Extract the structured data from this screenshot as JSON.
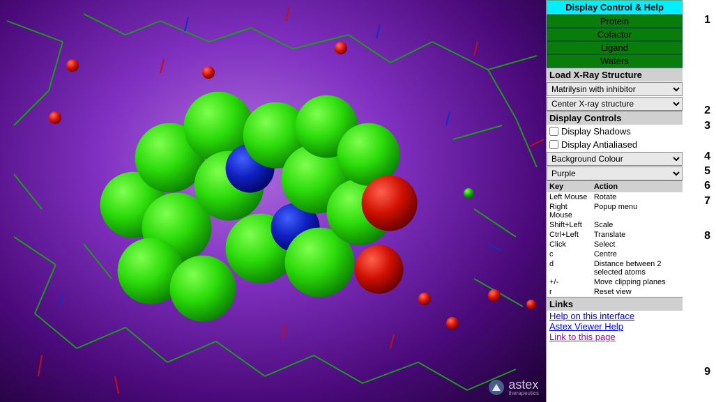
{
  "logo": {
    "name": "astex",
    "sub": "therapeutics"
  },
  "sidebar": {
    "title": "Display Control & Help",
    "green_items": [
      "Protein",
      "Cofactor",
      "Ligand",
      "Waters"
    ],
    "load_header": "Load X-Ray Structure",
    "structure_select": "Matrilysin with inhibitor",
    "center_select": "Center X-ray structure",
    "controls_header": "Display Controls",
    "shadows_label": "Display Shadows",
    "antialias_label": "Display Antialiased",
    "bgcolor_label": "Background Colour",
    "bgcolor_value": "Purple",
    "key_header": "Key",
    "action_header": "Action",
    "keys": [
      {
        "k": "Left Mouse",
        "a": "Rotate"
      },
      {
        "k": "Right Mouse",
        "a": "Popup menu"
      },
      {
        "k": "Shift+Left",
        "a": "Scale"
      },
      {
        "k": "Ctrl+Left",
        "a": "Translate"
      },
      {
        "k": "Click",
        "a": "Select"
      },
      {
        "k": "c",
        "a": "Centre"
      },
      {
        "k": "d",
        "a": "Distance between 2 selected atoms"
      },
      {
        "k": "+/-",
        "a": "Move clipping planes"
      },
      {
        "k": "r",
        "a": "Reset view"
      }
    ],
    "links_header": "Links",
    "links": [
      {
        "label": "Help on this interface",
        "visited": false
      },
      {
        "label": "Astex Viewer Help",
        "visited": false
      },
      {
        "label": "Link to this page",
        "visited": true
      }
    ]
  },
  "annotations": [
    "1",
    "2",
    "3",
    "4",
    "5",
    "6",
    "7",
    "8",
    "9"
  ]
}
